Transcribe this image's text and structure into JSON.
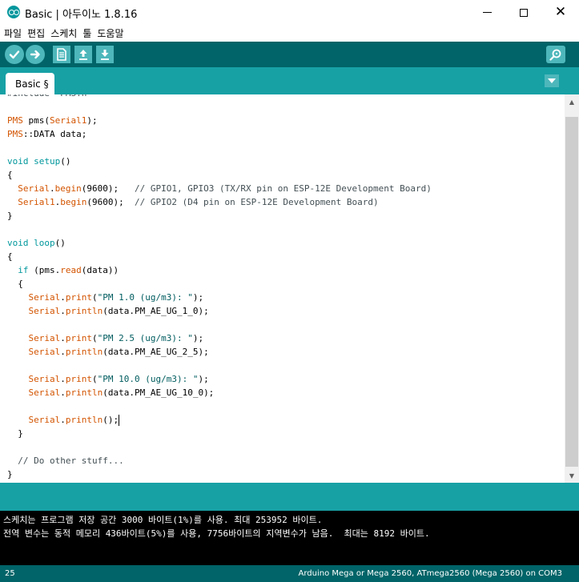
{
  "window": {
    "title": "Basic | 아두이노 1.8.16"
  },
  "menu": {
    "items": [
      "파일",
      "편집",
      "스케치",
      "툴",
      "도움말"
    ]
  },
  "toolbar": {
    "buttons": [
      "verify-icon",
      "upload-icon",
      "new-icon",
      "open-icon",
      "save-icon",
      "serial-monitor-icon"
    ]
  },
  "tabs": {
    "active": "Basic §"
  },
  "editor": {
    "lines": [
      {
        "segs": [
          {
            "t": "#include \"PMS.h\"",
            "c": "cm"
          }
        ]
      },
      {
        "segs": []
      },
      {
        "segs": [
          {
            "t": "PMS",
            "c": "kw1"
          },
          {
            "t": " pms(",
            "c": ""
          },
          {
            "t": "Serial1",
            "c": "kw1"
          },
          {
            "t": ");",
            "c": ""
          }
        ]
      },
      {
        "segs": [
          {
            "t": "PMS",
            "c": "kw1"
          },
          {
            "t": "::DATA data;",
            "c": ""
          }
        ]
      },
      {
        "segs": []
      },
      {
        "segs": [
          {
            "t": "void",
            "c": "kw2"
          },
          {
            "t": " ",
            "c": ""
          },
          {
            "t": "setup",
            "c": "kw2"
          },
          {
            "t": "()",
            "c": ""
          }
        ]
      },
      {
        "segs": [
          {
            "t": "{",
            "c": ""
          }
        ]
      },
      {
        "segs": [
          {
            "t": "  ",
            "c": ""
          },
          {
            "t": "Serial",
            "c": "kw1"
          },
          {
            "t": ".",
            "c": ""
          },
          {
            "t": "begin",
            "c": "kw1"
          },
          {
            "t": "(9600);   ",
            "c": ""
          },
          {
            "t": "// GPIO1, GPIO3 (TX/RX pin on ESP-12E Development Board)",
            "c": "cm"
          }
        ]
      },
      {
        "segs": [
          {
            "t": "  ",
            "c": ""
          },
          {
            "t": "Serial1",
            "c": "kw1"
          },
          {
            "t": ".",
            "c": ""
          },
          {
            "t": "begin",
            "c": "kw1"
          },
          {
            "t": "(9600);  ",
            "c": ""
          },
          {
            "t": "// GPIO2 (D4 pin on ESP-12E Development Board)",
            "c": "cm"
          }
        ]
      },
      {
        "segs": [
          {
            "t": "}",
            "c": ""
          }
        ]
      },
      {
        "segs": []
      },
      {
        "segs": [
          {
            "t": "void",
            "c": "kw2"
          },
          {
            "t": " ",
            "c": ""
          },
          {
            "t": "loop",
            "c": "kw2"
          },
          {
            "t": "()",
            "c": ""
          }
        ]
      },
      {
        "segs": [
          {
            "t": "{",
            "c": ""
          }
        ]
      },
      {
        "segs": [
          {
            "t": "  ",
            "c": ""
          },
          {
            "t": "if",
            "c": "kw2"
          },
          {
            "t": " (pms.",
            "c": ""
          },
          {
            "t": "read",
            "c": "kw1"
          },
          {
            "t": "(data))",
            "c": ""
          }
        ]
      },
      {
        "segs": [
          {
            "t": "  {",
            "c": ""
          }
        ]
      },
      {
        "segs": [
          {
            "t": "    ",
            "c": ""
          },
          {
            "t": "Serial",
            "c": "kw1"
          },
          {
            "t": ".",
            "c": ""
          },
          {
            "t": "print",
            "c": "kw1"
          },
          {
            "t": "(",
            "c": ""
          },
          {
            "t": "\"PM 1.0 (ug/m3): \"",
            "c": "str"
          },
          {
            "t": ");",
            "c": ""
          }
        ]
      },
      {
        "segs": [
          {
            "t": "    ",
            "c": ""
          },
          {
            "t": "Serial",
            "c": "kw1"
          },
          {
            "t": ".",
            "c": ""
          },
          {
            "t": "println",
            "c": "kw1"
          },
          {
            "t": "(data.PM_AE_UG_1_0);",
            "c": ""
          }
        ]
      },
      {
        "segs": []
      },
      {
        "segs": [
          {
            "t": "    ",
            "c": ""
          },
          {
            "t": "Serial",
            "c": "kw1"
          },
          {
            "t": ".",
            "c": ""
          },
          {
            "t": "print",
            "c": "kw1"
          },
          {
            "t": "(",
            "c": ""
          },
          {
            "t": "\"PM 2.5 (ug/m3): \"",
            "c": "str"
          },
          {
            "t": ");",
            "c": ""
          }
        ]
      },
      {
        "segs": [
          {
            "t": "    ",
            "c": ""
          },
          {
            "t": "Serial",
            "c": "kw1"
          },
          {
            "t": ".",
            "c": ""
          },
          {
            "t": "println",
            "c": "kw1"
          },
          {
            "t": "(data.PM_AE_UG_2_5);",
            "c": ""
          }
        ]
      },
      {
        "segs": []
      },
      {
        "segs": [
          {
            "t": "    ",
            "c": ""
          },
          {
            "t": "Serial",
            "c": "kw1"
          },
          {
            "t": ".",
            "c": ""
          },
          {
            "t": "print",
            "c": "kw1"
          },
          {
            "t": "(",
            "c": ""
          },
          {
            "t": "\"PM 10.0 (ug/m3): \"",
            "c": "str"
          },
          {
            "t": ");",
            "c": ""
          }
        ]
      },
      {
        "segs": [
          {
            "t": "    ",
            "c": ""
          },
          {
            "t": "Serial",
            "c": "kw1"
          },
          {
            "t": ".",
            "c": ""
          },
          {
            "t": "println",
            "c": "kw1"
          },
          {
            "t": "(data.PM_AE_UG_10_0);",
            "c": ""
          }
        ]
      },
      {
        "segs": []
      },
      {
        "segs": [
          {
            "t": "    ",
            "c": ""
          },
          {
            "t": "Serial",
            "c": "kw1"
          },
          {
            "t": ".",
            "c": ""
          },
          {
            "t": "println",
            "c": "kw1"
          },
          {
            "t": "();",
            "c": ""
          }
        ],
        "caret": true
      },
      {
        "segs": [
          {
            "t": "  }",
            "c": ""
          }
        ]
      },
      {
        "segs": []
      },
      {
        "segs": [
          {
            "t": "  ",
            "c": ""
          },
          {
            "t": "// Do other stuff...",
            "c": "cm"
          }
        ]
      },
      {
        "segs": [
          {
            "t": "}",
            "c": ""
          }
        ]
      }
    ]
  },
  "console": {
    "lines": [
      "스케치는 프로그램 저장 공간 3000 바이트(1%)를 사용. 최대 253952 바이트.",
      "전역 변수는 동적 메모리 436바이트(5%)를 사용, 7756바이트의 지역변수가 남음.  최대는 8192 바이트."
    ]
  },
  "status": {
    "line_number": "25",
    "board": "Arduino Mega or Mega 2560, ATmega2560 (Mega 2560) on COM3"
  },
  "colors": {
    "toolbar": "#006468",
    "tabstrip": "#17a1a5",
    "button": "#4db7bb",
    "keyword_orange": "#d35400",
    "keyword_teal": "#00979c"
  }
}
